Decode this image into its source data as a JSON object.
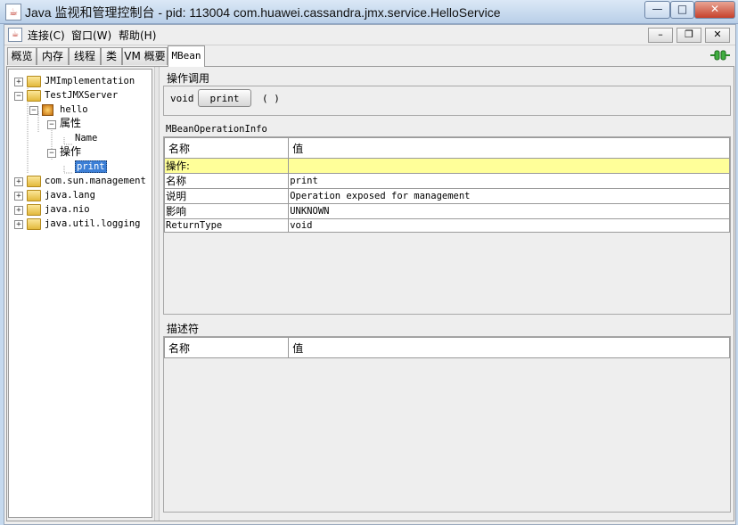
{
  "window": {
    "title": "Java 监视和管理控制台 - pid: 113004 com.huawei.cassandra.jmx.service.HelloService",
    "minimize": "—",
    "maximize": "□",
    "close": "✕"
  },
  "menu": {
    "items": [
      "连接(C)",
      "窗口(W)",
      "帮助(H)"
    ],
    "inner_minimize": "–",
    "inner_restore": "❐",
    "inner_close": "✕"
  },
  "tabs": [
    {
      "label": "概览"
    },
    {
      "label": "内存"
    },
    {
      "label": "线程"
    },
    {
      "label": "类"
    },
    {
      "label": "VM 概要"
    },
    {
      "label": "MBean",
      "active": true
    }
  ],
  "tree": {
    "nodes": [
      {
        "label": "JMImplementation",
        "expander": "+"
      },
      {
        "label": "TestJMXServer",
        "expander": "−"
      },
      {
        "label": "hello",
        "expander": "−"
      },
      {
        "label": "属性",
        "expander": "−"
      },
      {
        "label": "Name"
      },
      {
        "label": "操作",
        "expander": "−"
      },
      {
        "label": "print",
        "selected": true
      },
      {
        "label": "com.sun.management",
        "expander": "+"
      },
      {
        "label": "java.lang",
        "expander": "+"
      },
      {
        "label": "java.nio",
        "expander": "+"
      },
      {
        "label": "java.util.logging",
        "expander": "+"
      }
    ]
  },
  "operation": {
    "section_title": "操作调用",
    "return_type": "void",
    "button_label": "print",
    "params": "( )"
  },
  "info": {
    "section_title": "MBeanOperationInfo",
    "col_name": "名称",
    "col_value": "值",
    "rows": [
      {
        "name": "操作:",
        "value": "",
        "highlight": true
      },
      {
        "name": "名称",
        "value": "print"
      },
      {
        "name": "说明",
        "value": "Operation exposed for management"
      },
      {
        "name": "影响",
        "value": "UNKNOWN"
      },
      {
        "name": "ReturnType",
        "value": "void"
      }
    ]
  },
  "descriptor": {
    "section_title": "描述符",
    "col_name": "名称",
    "col_value": "值"
  },
  "colors": {
    "selection": "#3c7fd6",
    "highlight_row": "#ffff99"
  }
}
